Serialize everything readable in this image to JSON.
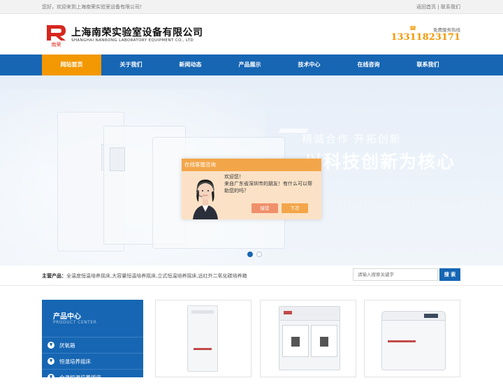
{
  "topbar": {
    "welcome": "您好，欢迎来到上海南荣实验室设备有限公司！",
    "link_home": "返回首页",
    "separator": "|",
    "link_contact": "联系我们"
  },
  "header": {
    "logo_mark_text": "南荣",
    "company_cn": "上海南荣实验室设备有限公司",
    "company_en": "SHANGHAI NANRONG LABORATORY EQUIPMENT CO., LTD",
    "hotline_label": "免费服务热线",
    "hotline_number": "13311823171"
  },
  "nav": {
    "items": [
      {
        "label": "网站首页",
        "active": true
      },
      {
        "label": "关于我们"
      },
      {
        "label": "新闻动态"
      },
      {
        "label": "产品展示"
      },
      {
        "label": "技术中心"
      },
      {
        "label": "在线咨询"
      },
      {
        "label": "联系我们"
      }
    ]
  },
  "banner": {
    "slogan_sub": "精诚合作 开拓创新",
    "slogan_main": "以科技创新为核心",
    "slide_count": 2,
    "active_slide": 1
  },
  "chat": {
    "title": "在线客服咨询",
    "greeting": "欢迎您！",
    "message": "来自广东省深圳市的朋友！有什么可以帮助您的吗？",
    "accept_label": "接受",
    "later_label": "下次"
  },
  "search_strip": {
    "hot_label": "主营产品：",
    "hot_products": "全温度恒温培养摇床,大容量恒温培养摇床,立式恒温培养摇床,远红外二氧化碳培养箱",
    "search_placeholder": "请输入搜索关键字",
    "search_button": "搜 索"
  },
  "sidebar": {
    "title": "产品中心",
    "title_en": "PRODUCT CENTER",
    "items": [
      {
        "label": "厌氧箱"
      },
      {
        "label": "恒温培养摇床"
      },
      {
        "label": "全温恒温培养摇床"
      }
    ]
  },
  "colors": {
    "brand_blue": "#1666b3",
    "accent_orange": "#f39800",
    "chat_header": "#f3a649"
  }
}
